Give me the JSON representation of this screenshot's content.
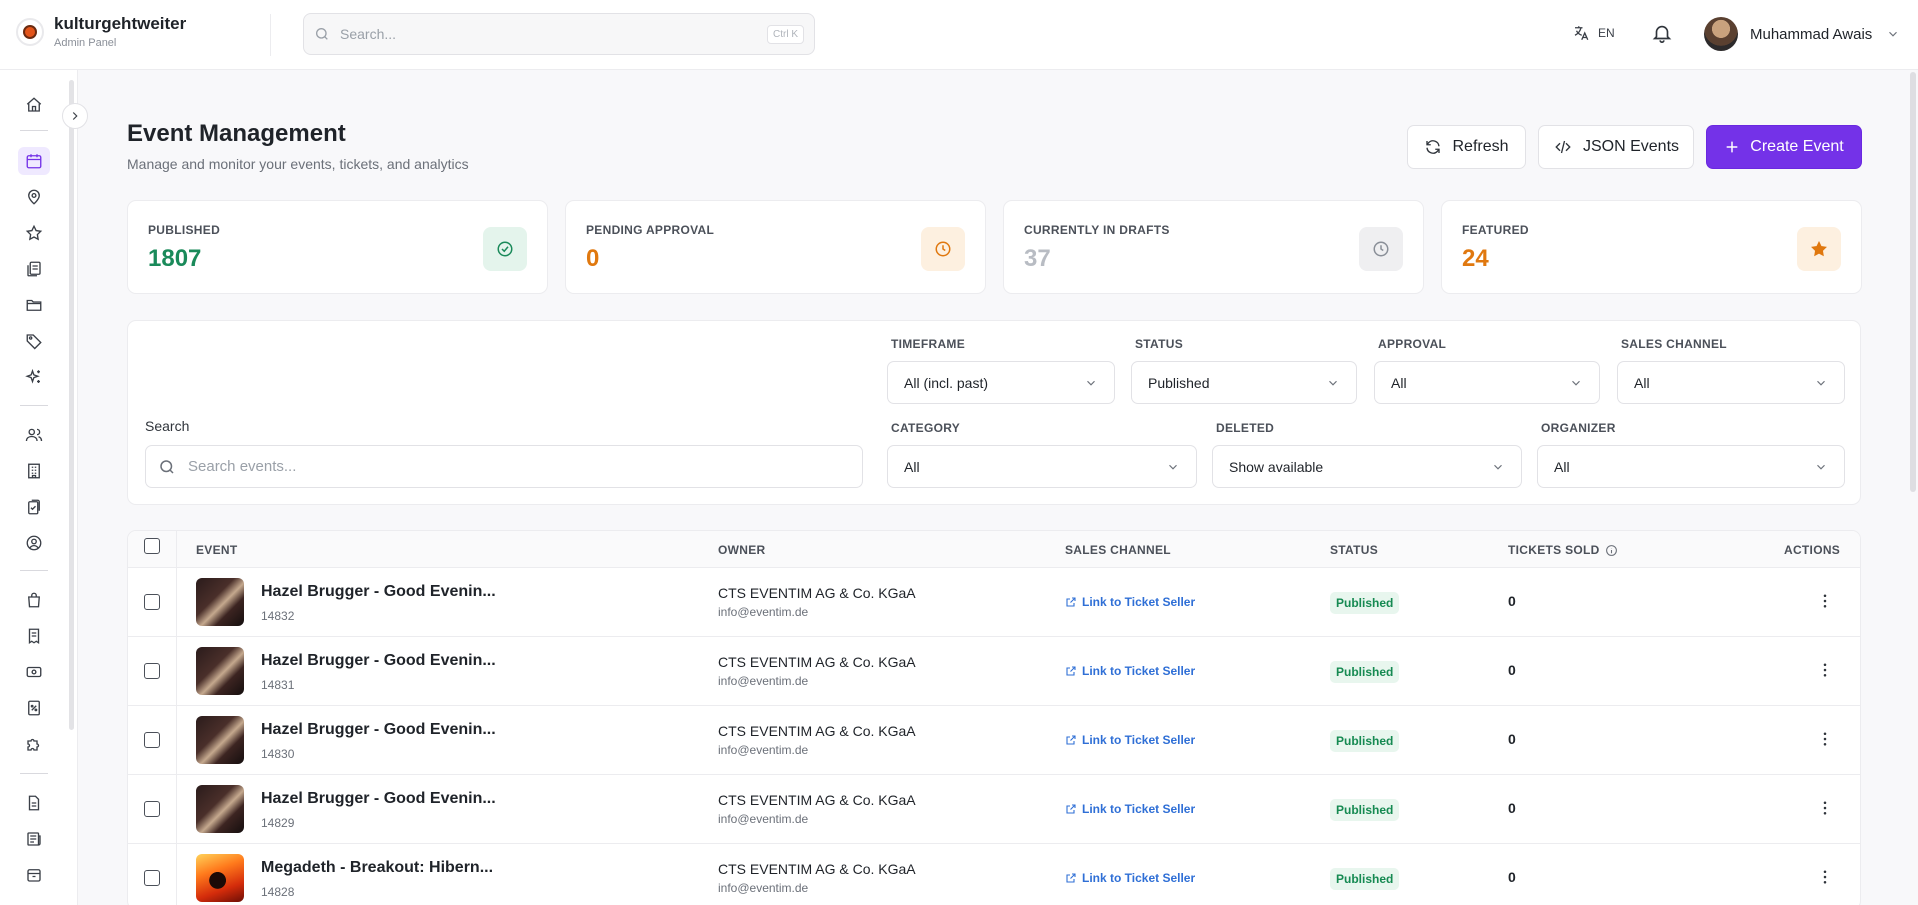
{
  "app": {
    "name": "kulturgehtweiter",
    "subtitle": "Admin Panel"
  },
  "topbar": {
    "search_placeholder": "Search...",
    "search_shortcut": "Ctrl K",
    "language": "EN",
    "user_name": "Muhammad Awais"
  },
  "sidebar": {
    "icons": [
      "home-icon",
      "calendar-icon",
      "location-pin-icon",
      "star-icon",
      "documents-icon",
      "folder-icon",
      "tag-icon",
      "sparkles-icon",
      "users-icon",
      "building-icon",
      "clipboard-icon",
      "user-circle-icon",
      "shopping-bag-icon",
      "receipt-icon",
      "banknote-icon",
      "discount-icon",
      "puzzle-icon",
      "file-icon",
      "newspaper-icon",
      "archive-icon"
    ],
    "active": "calendar-icon"
  },
  "page": {
    "title": "Event Management",
    "subtitle": "Manage and monitor your events, tickets, and analytics"
  },
  "actions": {
    "refresh": "Refresh",
    "json_events": "JSON Events",
    "create_event": "Create Event"
  },
  "stats": [
    {
      "label": "PUBLISHED",
      "value": "1807",
      "color": "#1a8a5a"
    },
    {
      "label": "PENDING APPROVAL",
      "value": "0",
      "color": "#e0780f"
    },
    {
      "label": "CURRENTLY IN DRAFTS",
      "value": "37",
      "color": "#b8bcc3"
    },
    {
      "label": "FEATURED",
      "value": "24",
      "color": "#e0780f"
    }
  ],
  "filters": {
    "search_label": "Search",
    "search_placeholder": "Search events...",
    "timeframe": {
      "label": "TIMEFRAME",
      "value": "All (incl. past)"
    },
    "status": {
      "label": "STATUS",
      "value": "Published"
    },
    "approval": {
      "label": "APPROVAL",
      "value": "All"
    },
    "sales_channel": {
      "label": "SALES CHANNEL",
      "value": "All"
    },
    "category": {
      "label": "CATEGORY",
      "value": "All"
    },
    "deleted": {
      "label": "DELETED",
      "value": "Show available"
    },
    "organizer": {
      "label": "ORGANIZER",
      "value": "All"
    }
  },
  "table": {
    "columns": {
      "event": "EVENT",
      "owner": "OWNER",
      "sales_channel": "SALES CHANNEL",
      "status": "STATUS",
      "tickets_sold": "TICKETS SOLD",
      "actions": "ACTIONS"
    },
    "rows": [
      {
        "title": "Hazel Brugger - Good Evenin...",
        "id": "14832",
        "owner": "CTS EVENTIM AG & Co. KGaA",
        "email": "info@eventim.de",
        "channel": "Link to Ticket Seller",
        "status": "Published",
        "sold": "0",
        "thumb": "dark"
      },
      {
        "title": "Hazel Brugger - Good Evenin...",
        "id": "14831",
        "owner": "CTS EVENTIM AG & Co. KGaA",
        "email": "info@eventim.de",
        "channel": "Link to Ticket Seller",
        "status": "Published",
        "sold": "0",
        "thumb": "dark"
      },
      {
        "title": "Hazel Brugger - Good Evenin...",
        "id": "14830",
        "owner": "CTS EVENTIM AG & Co. KGaA",
        "email": "info@eventim.de",
        "channel": "Link to Ticket Seller",
        "status": "Published",
        "sold": "0",
        "thumb": "dark"
      },
      {
        "title": "Hazel Brugger - Good Evenin...",
        "id": "14829",
        "owner": "CTS EVENTIM AG & Co. KGaA",
        "email": "info@eventim.de",
        "channel": "Link to Ticket Seller",
        "status": "Published",
        "sold": "0",
        "thumb": "dark"
      },
      {
        "title": "Megadeth - Breakout: Hibern...",
        "id": "14828",
        "owner": "CTS EVENTIM AG & Co. KGaA",
        "email": "info@eventim.de",
        "channel": "Link to Ticket Seller",
        "status": "Published",
        "sold": "0",
        "thumb": "red"
      }
    ]
  }
}
